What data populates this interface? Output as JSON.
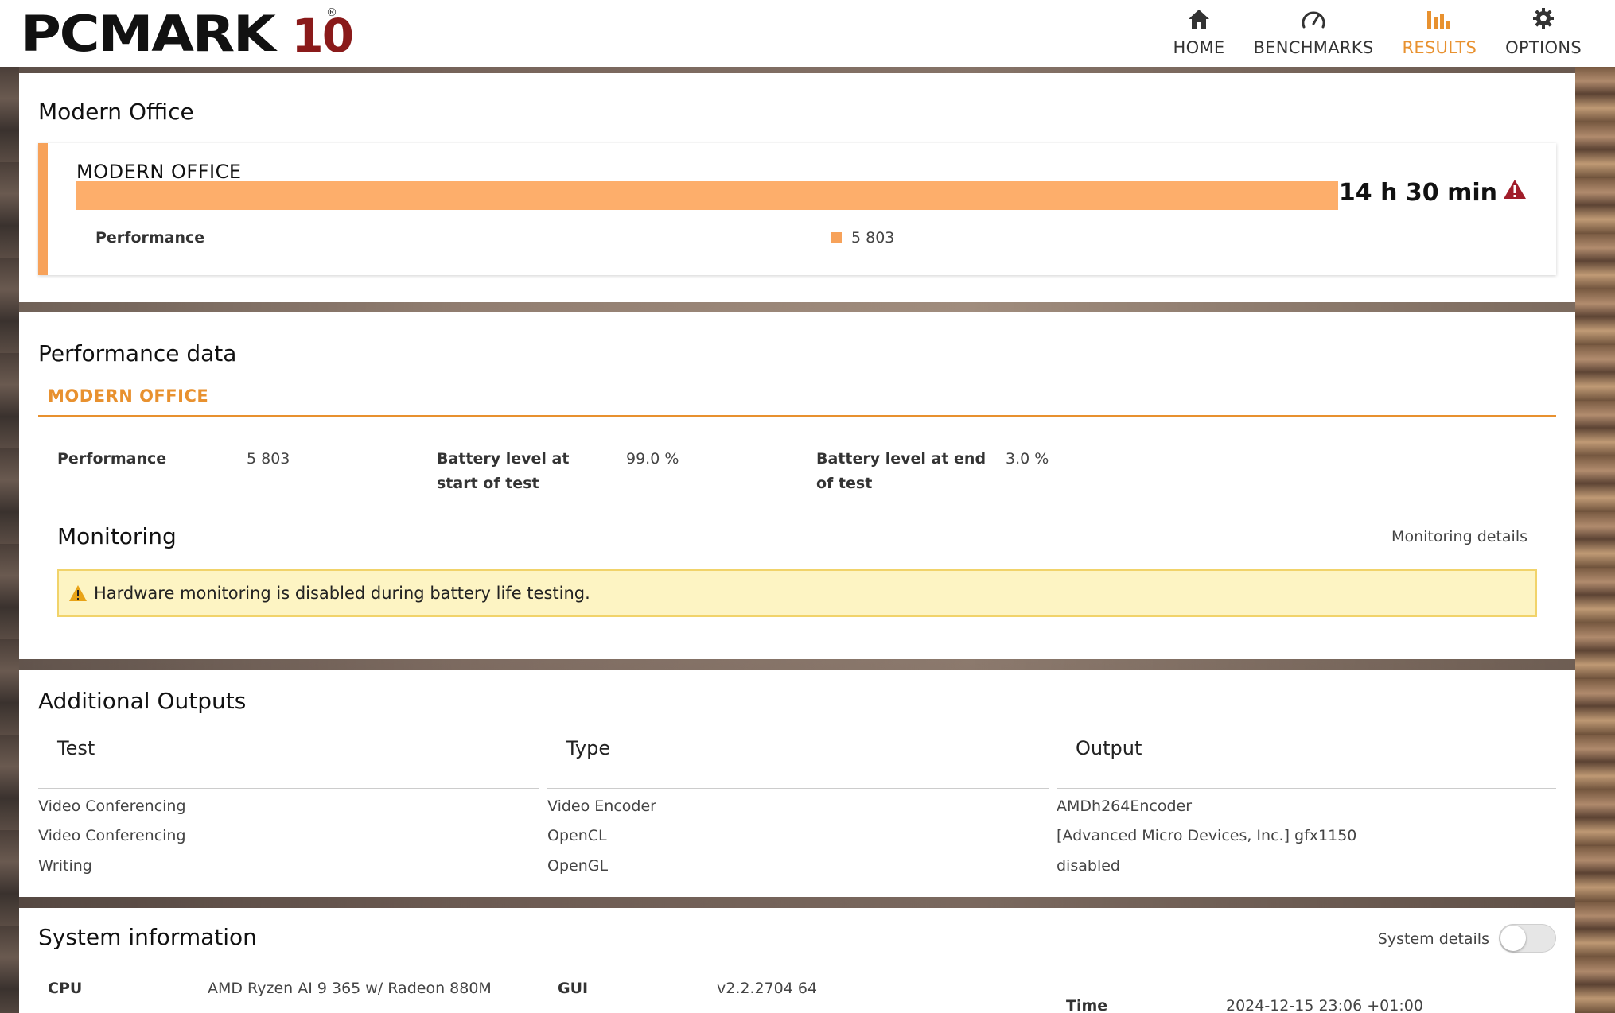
{
  "header": {
    "logo_main": "PCMARK",
    "logo_num": "10",
    "logo_reg": "®",
    "nav": [
      {
        "label": "HOME",
        "icon": "home-icon",
        "active": false
      },
      {
        "label": "BENCHMARKS",
        "icon": "gauge-icon",
        "active": false
      },
      {
        "label": "RESULTS",
        "icon": "bar-chart-icon",
        "active": true
      },
      {
        "label": "OPTIONS",
        "icon": "gear-icon",
        "active": false
      }
    ]
  },
  "modern_office": {
    "title": "Modern Office",
    "card_title": "MODERN OFFICE",
    "score": "14 h 30 min",
    "perf_label": "Performance",
    "perf_value": "5 803",
    "bar_fill": 1.0,
    "accent": "#f7a25a",
    "warning_color": "#a11d2a"
  },
  "performance_data": {
    "title": "Performance data",
    "tab": "MODERN OFFICE",
    "items": [
      {
        "key": "Performance",
        "value": "5 803"
      },
      {
        "key": "Battery level at start of test",
        "key_lines": [
          "Battery level at",
          "start of test"
        ],
        "value": "99.0 %"
      },
      {
        "key": "Battery level at end of test",
        "key_lines": [
          "Battery level at end",
          "of test"
        ],
        "value": "3.0 %"
      }
    ],
    "monitoring": {
      "title": "Monitoring",
      "details_link": "Monitoring details",
      "alert": "Hardware monitoring is disabled during battery life testing."
    }
  },
  "additional_outputs": {
    "title": "Additional Outputs",
    "columns": [
      "Test",
      "Type",
      "Output"
    ],
    "rows": [
      [
        "Video Conferencing",
        "Video Encoder",
        "AMDh264Encoder"
      ],
      [
        "Video Conferencing",
        "OpenCL",
        "[Advanced Micro Devices, Inc.] gfx1150"
      ],
      [
        "Writing",
        "OpenGL",
        "disabled"
      ]
    ]
  },
  "system_info": {
    "title": "System information",
    "details_label": "System details",
    "details_enabled": false,
    "cpu_label": "CPU",
    "cpu_value": "AMD Ryzen AI 9 365 w/ Radeon 880M",
    "gui_label": "GUI",
    "gui_value": "v2.2.2704 64",
    "time_label": "Time",
    "time_value": "2024-12-15 23:06 +01:00"
  }
}
